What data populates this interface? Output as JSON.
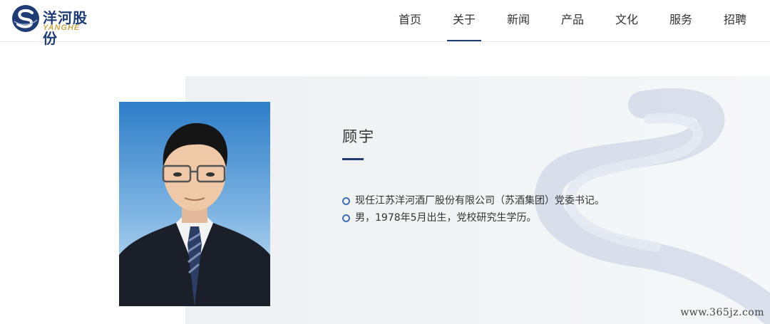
{
  "brand": {
    "name_cn": "洋河股份",
    "name_en": "YANGHE",
    "colors": {
      "primary": "#1f3c75",
      "gold": "#c9a84b",
      "accent": "#3d6fb5"
    }
  },
  "nav": {
    "items": [
      {
        "label": "首页"
      },
      {
        "label": "关于",
        "active": true
      },
      {
        "label": "新闻"
      },
      {
        "label": "产品"
      },
      {
        "label": "文化"
      },
      {
        "label": "服务"
      },
      {
        "label": "招聘"
      }
    ]
  },
  "profile": {
    "name": "顾宇",
    "bio": [
      "现任江苏洋河酒厂股份有限公司（苏酒集团）党委书记。",
      "男，1978年5月出生，党校研究生学历。"
    ]
  },
  "watermark": "www.365jz.com"
}
